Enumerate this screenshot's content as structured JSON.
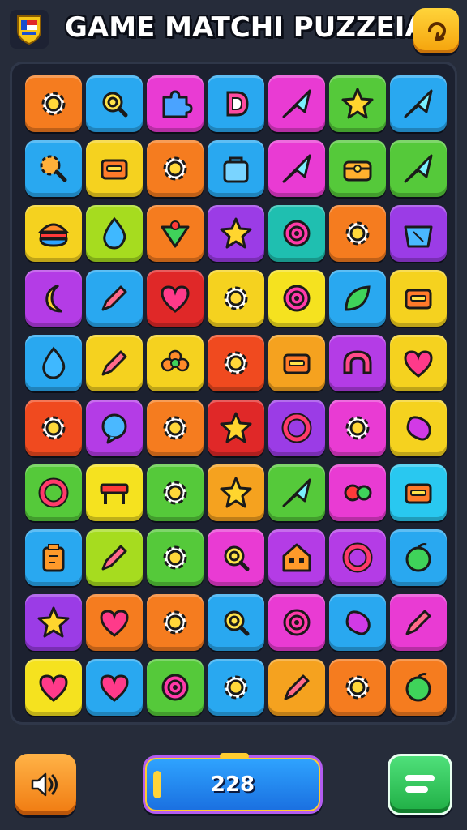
{
  "header": {
    "title": "GAME MATCHI PUZZEIA",
    "logo_icon": "badge-logo-icon",
    "top_button_icon": "refresh-hint-icon"
  },
  "board": {
    "rows": [
      [
        {
          "color": "#f57c1f",
          "icon": "gear"
        },
        {
          "color": "#29a8f0",
          "icon": "magnifier"
        },
        {
          "color": "#e93bd3",
          "icon": "puzzle"
        },
        {
          "color": "#29a8f0",
          "icon": "letter-d"
        },
        {
          "color": "#e93bd3",
          "icon": "arrow"
        },
        {
          "color": "#55c93a",
          "icon": "star"
        },
        {
          "color": "#29a8f0",
          "icon": "arrow"
        }
      ],
      [
        {
          "color": "#29a8f0",
          "icon": "gear-search"
        },
        {
          "color": "#f5d21f",
          "icon": "box"
        },
        {
          "color": "#f57c1f",
          "icon": "gear"
        },
        {
          "color": "#29a8f0",
          "icon": "bag"
        },
        {
          "color": "#e93bd3",
          "icon": "arrow"
        },
        {
          "color": "#55c93a",
          "icon": "chest"
        },
        {
          "color": "#55c93a",
          "icon": "arrow"
        }
      ],
      [
        {
          "color": "#f5d21f",
          "icon": "burger"
        },
        {
          "color": "#a6dc1f",
          "icon": "drop"
        },
        {
          "color": "#f57c1f",
          "icon": "arrow-down"
        },
        {
          "color": "#9b3ce6",
          "icon": "star"
        },
        {
          "color": "#1fbfb0",
          "icon": "target"
        },
        {
          "color": "#f57c1f",
          "icon": "gear"
        },
        {
          "color": "#9b3ce6",
          "icon": "basket"
        }
      ],
      [
        {
          "color": "#b43ce6",
          "icon": "moon"
        },
        {
          "color": "#29a8f0",
          "icon": "pencil"
        },
        {
          "color": "#e02828",
          "icon": "heart"
        },
        {
          "color": "#f5d21f",
          "icon": "gear"
        },
        {
          "color": "#f5e21f",
          "icon": "target"
        },
        {
          "color": "#29a8f0",
          "icon": "leaf"
        },
        {
          "color": "#f5d21f",
          "icon": "box"
        }
      ],
      [
        {
          "color": "#29a8f0",
          "icon": "drop"
        },
        {
          "color": "#f5d21f",
          "icon": "pencil"
        },
        {
          "color": "#f5d21f",
          "icon": "flower"
        },
        {
          "color": "#f04a1f",
          "icon": "gear"
        },
        {
          "color": "#f5a21f",
          "icon": "box"
        },
        {
          "color": "#b43ce6",
          "icon": "arch"
        },
        {
          "color": "#f5d21f",
          "icon": "heart"
        }
      ],
      [
        {
          "color": "#f04a1f",
          "icon": "gear"
        },
        {
          "color": "#b43ce6",
          "icon": "bubble"
        },
        {
          "color": "#f57c1f",
          "icon": "gear"
        },
        {
          "color": "#e02828",
          "icon": "star"
        },
        {
          "color": "#9b3ce6",
          "icon": "ring"
        },
        {
          "color": "#e93bd3",
          "icon": "gear"
        },
        {
          "color": "#f5d21f",
          "icon": "bean"
        }
      ],
      [
        {
          "color": "#55c93a",
          "icon": "ring"
        },
        {
          "color": "#f5e21f",
          "icon": "table"
        },
        {
          "color": "#55c93a",
          "icon": "gear"
        },
        {
          "color": "#f5a21f",
          "icon": "star"
        },
        {
          "color": "#55c93a",
          "icon": "arrow"
        },
        {
          "color": "#e93bd3",
          "icon": "candy"
        },
        {
          "color": "#29c8f0",
          "icon": "box"
        }
      ],
      [
        {
          "color": "#29a8f0",
          "icon": "jar"
        },
        {
          "color": "#a6dc1f",
          "icon": "pencil"
        },
        {
          "color": "#55c93a",
          "icon": "gear"
        },
        {
          "color": "#e93bd3",
          "icon": "magnifier"
        },
        {
          "color": "#b43ce6",
          "icon": "house"
        },
        {
          "color": "#b43ce6",
          "icon": "ring"
        },
        {
          "color": "#29a8f0",
          "icon": "apple"
        }
      ],
      [
        {
          "color": "#9b3ce6",
          "icon": "star"
        },
        {
          "color": "#f57c1f",
          "icon": "heart"
        },
        {
          "color": "#f57c1f",
          "icon": "gear"
        },
        {
          "color": "#29a8f0",
          "icon": "magnifier"
        },
        {
          "color": "#e93bd3",
          "icon": "target"
        },
        {
          "color": "#29a8f0",
          "icon": "bean"
        },
        {
          "color": "#e93bd3",
          "icon": "pencil"
        }
      ],
      [
        {
          "color": "#f5e21f",
          "icon": "heart"
        },
        {
          "color": "#29a8f0",
          "icon": "heart"
        },
        {
          "color": "#55c93a",
          "icon": "target"
        },
        {
          "color": "#29a8f0",
          "icon": "gear"
        },
        {
          "color": "#f5a21f",
          "icon": "pencil"
        },
        {
          "color": "#f57c1f",
          "icon": "gear"
        },
        {
          "color": "#f57c1f",
          "icon": "apple"
        }
      ]
    ]
  },
  "footer": {
    "left_button_icon": "sound-icon",
    "score": "228",
    "right_button_icon": "menu-icon"
  }
}
